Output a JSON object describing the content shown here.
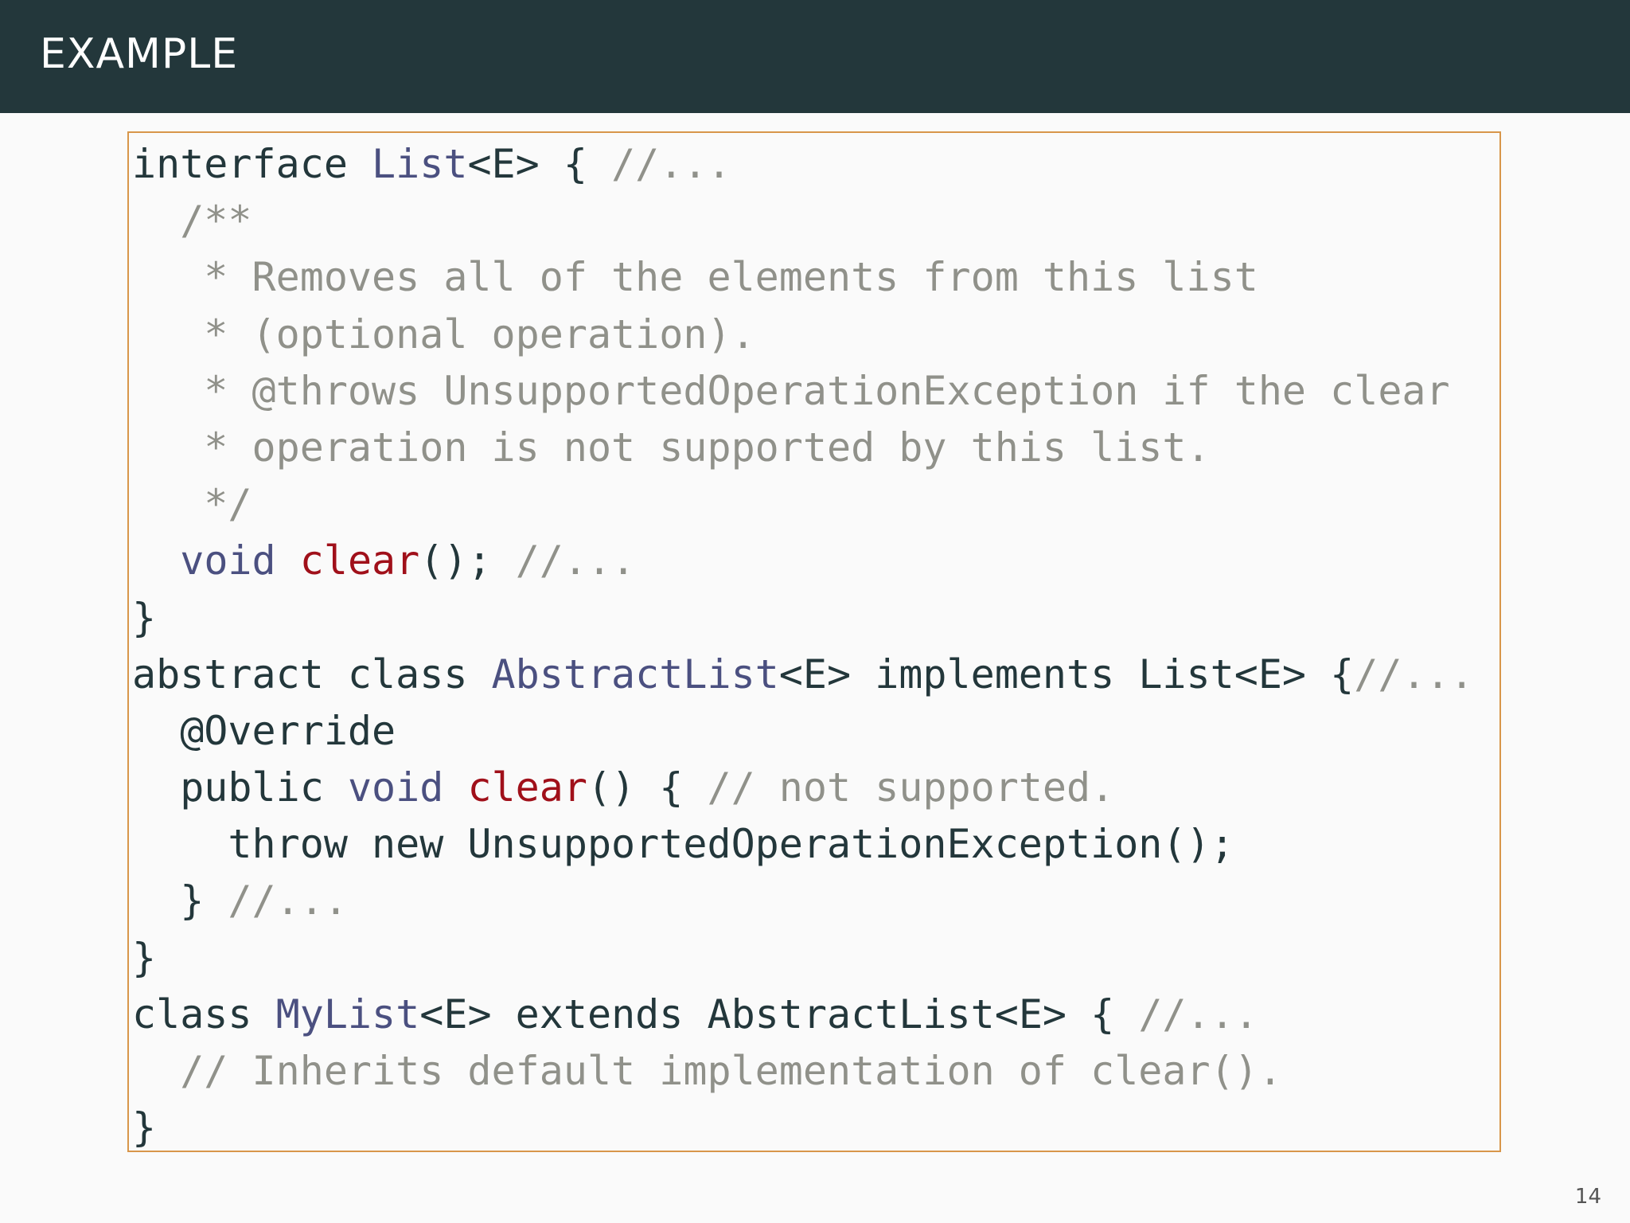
{
  "header": {
    "title": "EXAMPLE"
  },
  "code": {
    "lines": [
      [
        {
          "t": "interface ",
          "c": "kw"
        },
        {
          "t": "List",
          "c": "type"
        },
        {
          "t": "<E> { ",
          "c": "kw"
        },
        {
          "t": "//...",
          "c": "cm"
        }
      ],
      [
        {
          "t": "  /**",
          "c": "cm"
        }
      ],
      [
        {
          "t": "   * Removes all of the elements from this list",
          "c": "cm"
        }
      ],
      [
        {
          "t": "   * (optional operation).",
          "c": "cm"
        }
      ],
      [
        {
          "t": "   * @throws UnsupportedOperationException if the clear",
          "c": "cm"
        }
      ],
      [
        {
          "t": "   * operation is not supported by this list.",
          "c": "cm"
        }
      ],
      [
        {
          "t": "   */",
          "c": "cm"
        }
      ],
      [
        {
          "t": "  ",
          "c": "kw"
        },
        {
          "t": "void",
          "c": "type"
        },
        {
          "t": " ",
          "c": "kw"
        },
        {
          "t": "clear",
          "c": "fn"
        },
        {
          "t": "(); ",
          "c": "kw"
        },
        {
          "t": "//...",
          "c": "cm"
        }
      ],
      [
        {
          "t": "}",
          "c": "kw"
        }
      ],
      [
        {
          "t": "abstract class ",
          "c": "kw"
        },
        {
          "t": "AbstractList",
          "c": "type"
        },
        {
          "t": "<E> implements List<E> {",
          "c": "kw"
        },
        {
          "t": "//...",
          "c": "cm"
        }
      ],
      [
        {
          "t": "  @Override",
          "c": "kw"
        }
      ],
      [
        {
          "t": "  public ",
          "c": "kw"
        },
        {
          "t": "void",
          "c": "type"
        },
        {
          "t": " ",
          "c": "kw"
        },
        {
          "t": "clear",
          "c": "fn"
        },
        {
          "t": "() { ",
          "c": "kw"
        },
        {
          "t": "// not supported.",
          "c": "cm"
        }
      ],
      [
        {
          "t": "    throw new UnsupportedOperationException();",
          "c": "kw"
        }
      ],
      [
        {
          "t": "  } ",
          "c": "kw"
        },
        {
          "t": "//...",
          "c": "cm"
        }
      ],
      [
        {
          "t": "}",
          "c": "kw"
        }
      ],
      [
        {
          "t": "class ",
          "c": "kw"
        },
        {
          "t": "MyList",
          "c": "type"
        },
        {
          "t": "<E> extends AbstractList<E> { ",
          "c": "kw"
        },
        {
          "t": "//...",
          "c": "cm"
        }
      ],
      [
        {
          "t": "  // Inherits default implementation of clear().",
          "c": "cm"
        }
      ],
      [
        {
          "t": "}",
          "c": "kw"
        }
      ]
    ]
  },
  "footer": {
    "page_number": "14"
  },
  "colors": {
    "header_background": "#23373b",
    "frame_border": "#d8964a",
    "type_name": "#4b5080",
    "method_name": "#a0101a",
    "comment": "#90918a"
  }
}
